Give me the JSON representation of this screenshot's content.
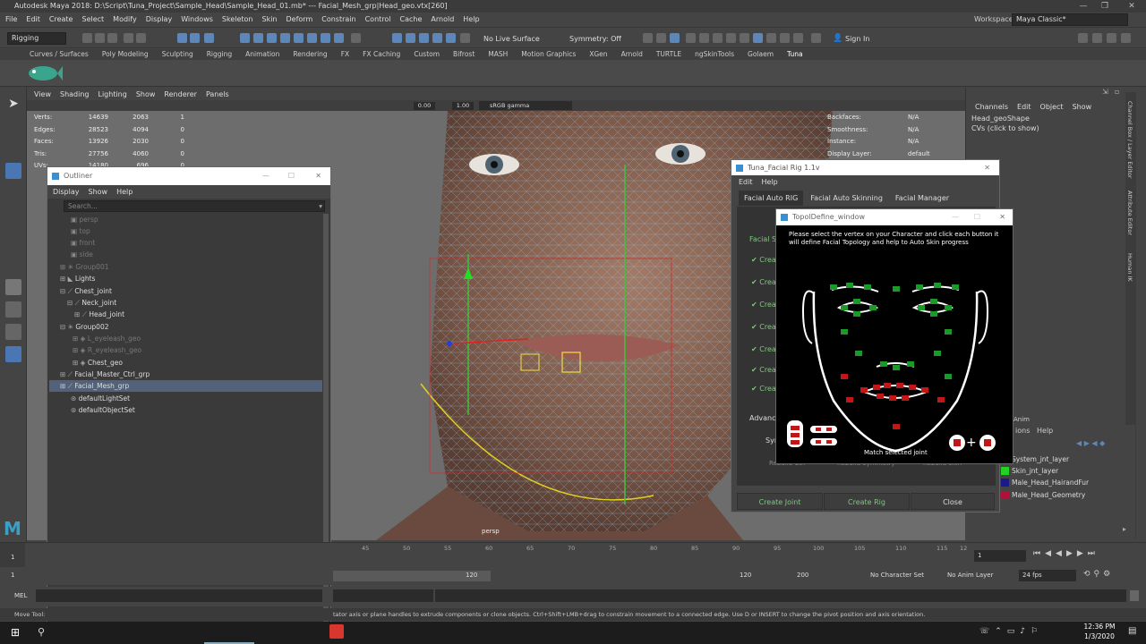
{
  "window": {
    "title": "Autodesk Maya 2018: D:\\Script\\Tuna_Project\\Sample_Head\\Sample_Head_01.mb*   ---   Facial_Mesh_grp|Head_geo.vtx[260]"
  },
  "menubar": [
    "File",
    "Edit",
    "Create",
    "Select",
    "Modify",
    "Display",
    "Windows",
    "Skeleton",
    "Skin",
    "Deform",
    "Constrain",
    "Control",
    "Cache",
    "Arnold",
    "Help"
  ],
  "workspace": {
    "label": "Workspace :",
    "value": "Maya Classic*"
  },
  "statusline": {
    "mode": "Rigging",
    "live_surface": "No Live Surface",
    "symmetry": "Symmetry: Off",
    "sign_in": "Sign In"
  },
  "shelf_tabs": [
    "Curves / Surfaces",
    "Poly Modeling",
    "Sculpting",
    "Rigging",
    "Animation",
    "Rendering",
    "FX",
    "FX Caching",
    "Custom",
    "Bifrost",
    "MASH",
    "Motion Graphics",
    "XGen",
    "Arnold",
    "TURTLE",
    "ngSkinTools",
    "Golaem",
    "Tuna"
  ],
  "shelf_active": "Tuna",
  "viewport": {
    "menu": [
      "View",
      "Shading",
      "Lighting",
      "Show",
      "Renderer",
      "Panels"
    ],
    "field1": "0.00",
    "field2": "1.00",
    "colorspace": "sRGB gamma",
    "camera": "persp",
    "hud": [
      {
        "label": "Verts:",
        "a": "14639",
        "b": "2063",
        "c": "1"
      },
      {
        "label": "Edges:",
        "a": "28523",
        "b": "4094",
        "c": "0"
      },
      {
        "label": "Faces:",
        "a": "13926",
        "b": "2030",
        "c": "0"
      },
      {
        "label": "Tris:",
        "a": "27756",
        "b": "4060",
        "c": "0"
      },
      {
        "label": "UVs:",
        "a": "14180",
        "b": "696",
        "c": "0"
      }
    ],
    "hud_right": [
      {
        "label": "Backfaces:",
        "value": "N/A"
      },
      {
        "label": "Smoothness:",
        "value": "N/A"
      },
      {
        "label": "Instance:",
        "value": "N/A"
      },
      {
        "label": "Display Layer:",
        "value": "default"
      }
    ]
  },
  "outliner": {
    "title": "Outliner",
    "menu": [
      "Display",
      "Show",
      "Help"
    ],
    "search_placeholder": "Search...",
    "items": [
      {
        "label": "persp",
        "dim": true,
        "indent": 0
      },
      {
        "label": "top",
        "dim": true,
        "indent": 0
      },
      {
        "label": "front",
        "dim": true,
        "indent": 0
      },
      {
        "label": "side",
        "dim": true,
        "indent": 0
      },
      {
        "label": "Group001",
        "dim": true,
        "indent": 0
      },
      {
        "label": "Lights",
        "dim": false,
        "indent": 0
      },
      {
        "label": "Chest_joint",
        "dim": false,
        "indent": 0
      },
      {
        "label": "Neck_joint",
        "dim": false,
        "indent": 1
      },
      {
        "label": "Head_joint",
        "dim": false,
        "indent": 2
      },
      {
        "label": "Group002",
        "dim": false,
        "indent": 0
      },
      {
        "label": "L_eyeleash_geo",
        "dim": true,
        "indent": 1
      },
      {
        "label": "R_eyeleash_geo",
        "dim": true,
        "indent": 1
      },
      {
        "label": "Chest_geo",
        "dim": false,
        "indent": 1
      },
      {
        "label": "Facial_Master_Ctrl_grp",
        "dim": false,
        "indent": 0
      },
      {
        "label": "Facial_Mesh_grp",
        "dim": false,
        "indent": 0,
        "selected": true
      },
      {
        "label": "defaultLightSet",
        "dim": false,
        "indent": 0
      },
      {
        "label": "defaultObjectSet",
        "dim": false,
        "indent": 0
      }
    ]
  },
  "channelbox": {
    "menu": [
      "Channels",
      "Edit",
      "Object",
      "Show"
    ],
    "shape": "Head_geoShape",
    "cvs": "CVs (click to show)",
    "side_tabs": [
      "Channel Box / Layer Editor",
      "Attribute Editor",
      "Human IK"
    ],
    "anim_label": "Anim",
    "layer_menu": [
      "ions",
      "Help"
    ],
    "layers": [
      {
        "name": "System_jnt_layer",
        "color": "#1f3fbf"
      },
      {
        "name": "Skin_jnt_layer",
        "color": "#22d322"
      },
      {
        "name": "Male_Head_HairandFur",
        "color": "#1a1a8a"
      },
      {
        "name": "Male_Head_Geometry",
        "color": "#b0103a"
      }
    ]
  },
  "tuna": {
    "title": "Tuna_Facial Rig 1.1v",
    "menu": [
      "Edit",
      "Help"
    ],
    "tabs": [
      "Facial Auto RIG",
      "Facial Auto Skinning",
      "Facial Manager"
    ],
    "section": "Facial Se",
    "rows": [
      "Crea",
      "Crea",
      "Crea",
      "Crea",
      "Crea",
      "Crea",
      "Crea"
    ],
    "advanced": "Advance",
    "sym": "Sym",
    "rebuild": [
      "Rebuild Ctrl",
      "Rebuild Symmetry",
      "Rebuild Skin"
    ],
    "buttons": {
      "create_joint": "Create Joint",
      "create_rig": "Create Rig",
      "close": "Close"
    }
  },
  "topo": {
    "title": "TopolDefine_window",
    "description": "Please select the vertex on your Character and click each button it will define Facial Topology and help to Auto Skin progress",
    "match_label": "Match selected joint"
  },
  "timeslider": {
    "ticks": [
      "45",
      "50",
      "55",
      "60",
      "65",
      "70",
      "75",
      "80",
      "85",
      "90",
      "95",
      "100",
      "105",
      "110",
      "115",
      "12"
    ],
    "current_frame": "1",
    "frame_field": "1"
  },
  "rangeslider": {
    "start": "1",
    "range_end_inner": "120",
    "end": "120",
    "max": "200",
    "character_set": "No Character Set",
    "anim_layer": "No Anim Layer",
    "fps": "24 fps"
  },
  "cmdline": {
    "lang": "MEL"
  },
  "helpline": {
    "left": "Move Tool: ",
    "text": "tator axis or plane handles to extrude components or clone objects. Ctrl+Shift+LMB+drag to constrain movement to a connected edge. Use D or INSERT to change the pivot position and axis orientation."
  },
  "taskbar": {
    "time": "12:36 PM",
    "date": "1/3/2020"
  }
}
